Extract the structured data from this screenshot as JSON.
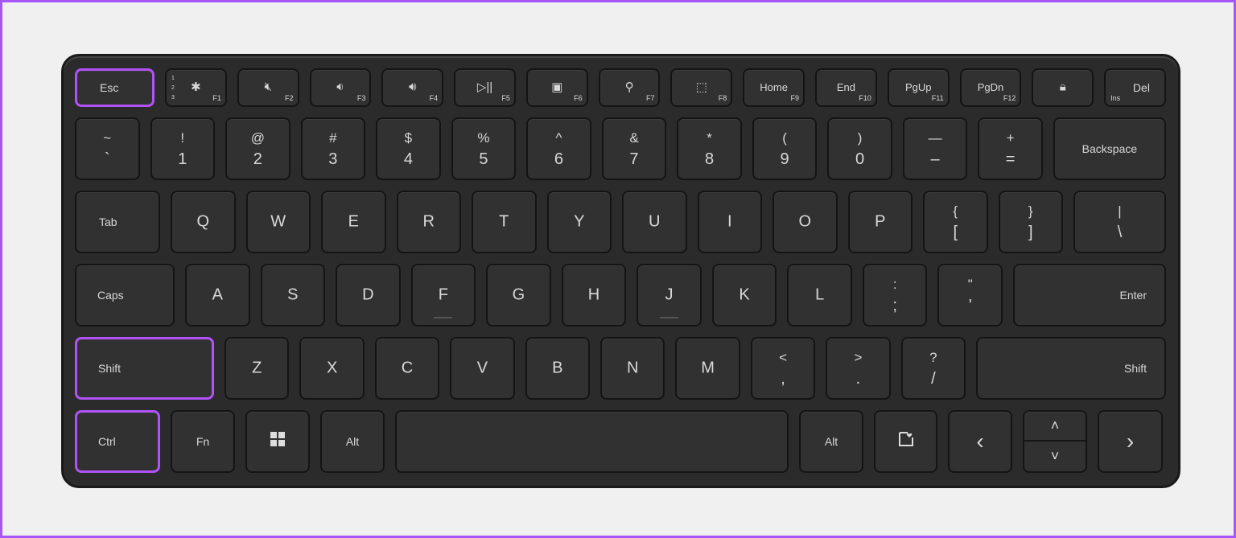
{
  "accent": "#b052f5",
  "highlighted": [
    "Esc",
    "Shift",
    "Ctrl"
  ],
  "row1": {
    "esc": "Esc",
    "fkeys": [
      {
        "icon": "bluetooth-icon",
        "glyph": "✱",
        "fn": "F1"
      },
      {
        "icon": "mute-icon",
        "glyph": "🔇︎",
        "fn": "F2"
      },
      {
        "icon": "volume-down-icon",
        "glyph": "🔉︎",
        "fn": "F3"
      },
      {
        "icon": "volume-up-icon",
        "glyph": "🔊︎",
        "fn": "F4"
      },
      {
        "icon": "play-pause-icon",
        "glyph": "▷||",
        "fn": "F5"
      },
      {
        "icon": "presentation-icon",
        "glyph": "▣",
        "fn": "F6"
      },
      {
        "icon": "search-icon",
        "glyph": "⚲",
        "fn": "F7"
      },
      {
        "icon": "snip-icon",
        "glyph": "⬚",
        "fn": "F8"
      },
      {
        "label": "Home",
        "fn": "F9"
      },
      {
        "label": "End",
        "fn": "F10"
      },
      {
        "label": "PgUp",
        "fn": "F11"
      },
      {
        "label": "PgDn",
        "fn": "F12"
      }
    ],
    "bt_channels": [
      "1",
      "2",
      "3"
    ],
    "lock": {
      "icon": "lock-icon",
      "glyph": "🔒︎"
    },
    "del": "Del",
    "ins": "Ins"
  },
  "row2": {
    "keys": [
      [
        "~",
        "`"
      ],
      [
        "!",
        "1"
      ],
      [
        "@",
        "2"
      ],
      [
        "#",
        "3"
      ],
      [
        "$",
        "4"
      ],
      [
        "%",
        "5"
      ],
      [
        "^",
        "6"
      ],
      [
        "&",
        "7"
      ],
      [
        "*",
        "8"
      ],
      [
        "(",
        "9"
      ],
      [
        ")",
        "0"
      ],
      [
        "—",
        "–"
      ],
      [
        "+",
        "="
      ]
    ],
    "backspace": "Backspace"
  },
  "row3": {
    "tab": "Tab",
    "keys": [
      "Q",
      "W",
      "E",
      "R",
      "T",
      "Y",
      "U",
      "I",
      "O",
      "P"
    ],
    "brackets": [
      [
        "{",
        "["
      ],
      [
        "}",
        "]"
      ],
      [
        "|",
        "\\"
      ]
    ]
  },
  "row4": {
    "caps": "Caps",
    "keys": [
      "A",
      "S",
      "D",
      "F",
      "G",
      "H",
      "J",
      "K",
      "L"
    ],
    "punct": [
      [
        ":",
        ";"
      ],
      [
        "\"",
        "'"
      ]
    ],
    "enter": "Enter"
  },
  "row5": {
    "shift_left": "Shift",
    "keys": [
      "Z",
      "X",
      "C",
      "V",
      "B",
      "N",
      "M"
    ],
    "punct": [
      [
        "<",
        ","
      ],
      [
        ">",
        "."
      ],
      [
        "?",
        "/"
      ]
    ],
    "shift_right": "Shift"
  },
  "row6": {
    "ctrl": "Ctrl",
    "fn": "Fn",
    "win_icon": "windows-icon",
    "alt_left": "Alt",
    "alt_right": "Alt",
    "menu_icon": "copilot-menu-icon",
    "left": "‹",
    "up": "˄",
    "down": "˅",
    "right": "›"
  }
}
